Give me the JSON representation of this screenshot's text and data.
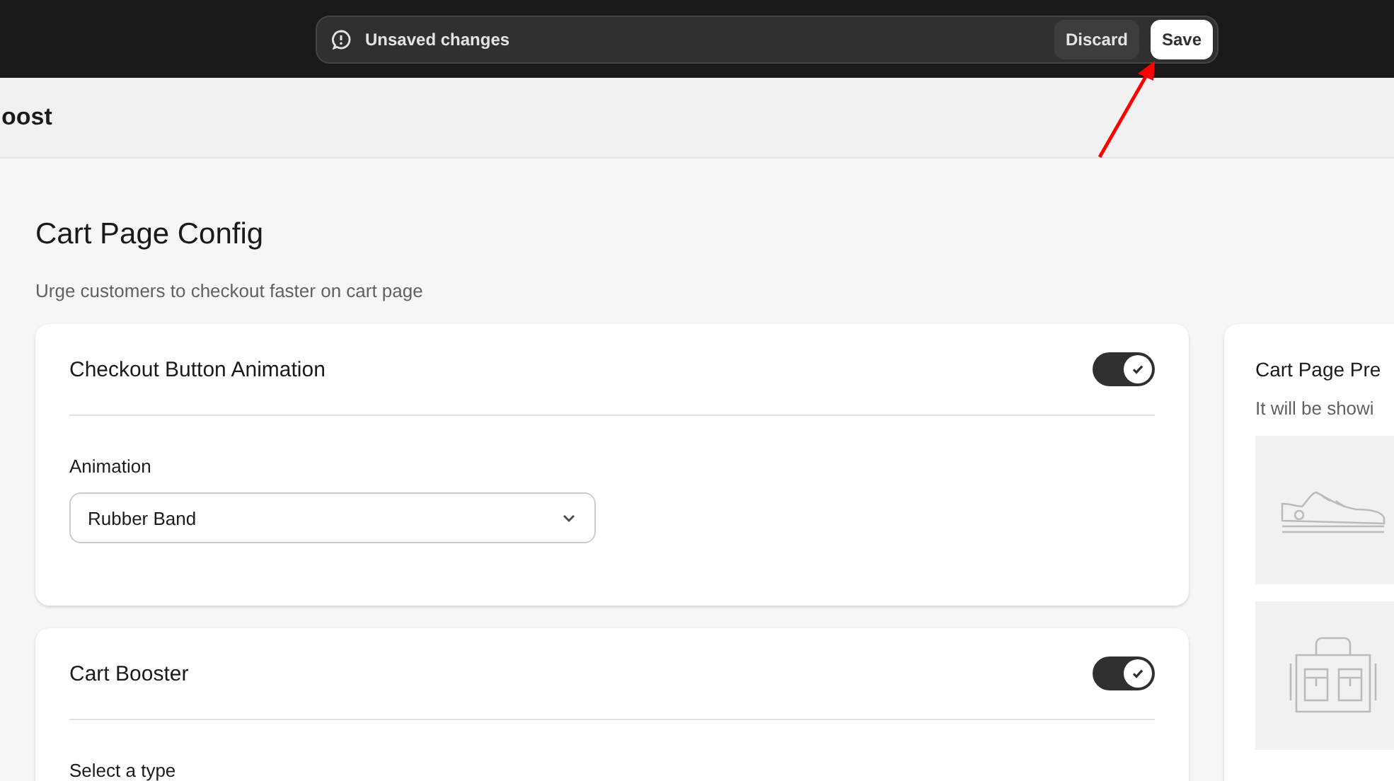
{
  "save_bar": {
    "message": "Unsaved changes",
    "buttons": [
      {
        "label": "Discard",
        "kind": "secondary"
      },
      {
        "label": "Save",
        "kind": "primary"
      }
    ]
  },
  "header": {
    "title": "oost"
  },
  "page": {
    "title": "Cart Page Config",
    "subtitle": "Urge customers to checkout faster on cart page"
  },
  "cards": [
    {
      "title": "Checkout Button Animation",
      "on": true,
      "field_label": "Animation",
      "select_value": "Rubber Band"
    },
    {
      "title": "Cart Booster",
      "on": true,
      "field_label": "Select a type"
    }
  ],
  "preview": {
    "title": "Cart Page Pre",
    "subtitle": "It will be showi"
  }
}
